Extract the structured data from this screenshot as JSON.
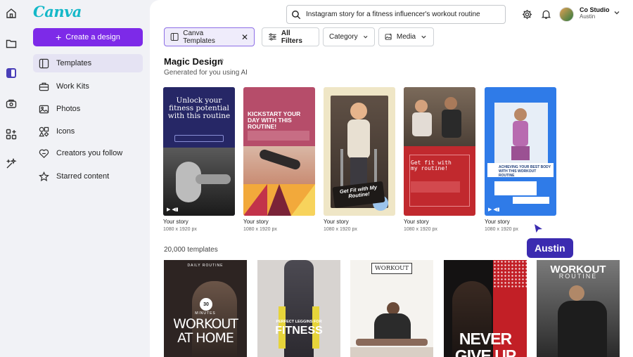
{
  "app": {
    "logo": "Canva"
  },
  "sidebar": {
    "create_label": "Create a design",
    "items": [
      {
        "label": "Templates",
        "icon": "template-icon"
      },
      {
        "label": "Work Kits",
        "icon": "briefcase-icon"
      },
      {
        "label": "Photos",
        "icon": "photo-icon"
      },
      {
        "label": "Icons",
        "icon": "shapes-icon"
      },
      {
        "label": "Creators you follow",
        "icon": "heart-icon"
      },
      {
        "label": "Starred content",
        "icon": "star-icon"
      }
    ]
  },
  "header": {
    "search_value": "Instagram story for a fitness influencer's workout routine",
    "account_name": "Co Studio",
    "account_user": "Austin"
  },
  "filters": {
    "active_chip": "Canva Templates",
    "all_filters": "All Filters",
    "category": "Category",
    "media": "Media"
  },
  "magic": {
    "title": "Magic Design",
    "subtitle": "Generated for you using AI",
    "cards": [
      {
        "label": "Your story",
        "dims": "1080 x 1920 px",
        "headline": "Unlock your fitness potential with this routine"
      },
      {
        "label": "Your story",
        "dims": "1080 x 1920 px",
        "headline": "KICKSTART YOUR DAY WITH THIS ROUTINE!"
      },
      {
        "label": "Your story",
        "dims": "1080 x 1920 px",
        "headline": "Get Fit with My Routine!"
      },
      {
        "label": "Your story",
        "dims": "1080 x 1920 px",
        "headline": "Get fit with my routine!"
      },
      {
        "label": "Your story",
        "dims": "1080 x 1920 px",
        "headline": "ACHIEVING YOUR BEST BODY WITH THIS WORKOUT ROUTINE"
      }
    ]
  },
  "templates": {
    "count_label": "20,000 templates",
    "items": [
      {
        "top": "DAILY ROUTINE",
        "num": "30",
        "small": "MINUTES",
        "main": "WORKOUT AT HOME"
      },
      {
        "top": "PERFECT LEGGINS FOR",
        "main": "FITNESS"
      },
      {
        "top": "WORKOUT"
      },
      {
        "main": "NEVER GIVE UP"
      },
      {
        "main": "WORKOUT",
        "small": "ROUTINE"
      }
    ]
  },
  "collab": {
    "user_tag": "Austin"
  },
  "colors": {
    "accent": "#7d2ae8",
    "active_nav": "#e5e3f3",
    "collab": "#3b2bb0",
    "logo": "#14b8c8"
  }
}
